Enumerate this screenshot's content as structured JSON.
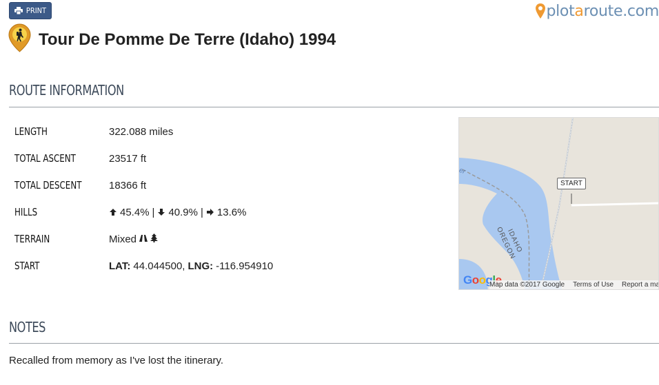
{
  "toolbar": {
    "print_label": "PRINT"
  },
  "brand": {
    "logo_part1": "plot",
    "logo_part2": "a",
    "logo_part3": "route.com"
  },
  "route": {
    "title": "Tour De Pomme De Terre (Idaho) 1994"
  },
  "sections": {
    "route_info": "ROUTE INFORMATION",
    "notes": "NOTES"
  },
  "info": {
    "length_label": "LENGTH",
    "length_value": "322.088 miles",
    "ascent_label": "TOTAL ASCENT",
    "ascent_value": "23517 ft",
    "descent_label": "TOTAL DESCENT",
    "descent_value": "18366 ft",
    "hills_label": "HILLS",
    "hills_up": "45.4%",
    "hills_sep1": "|",
    "hills_down": "40.9%",
    "hills_sep2": "|",
    "hills_flat": "13.6%",
    "terrain_label": "TERRAIN",
    "terrain_value": "Mixed",
    "start_label": "START",
    "lat_label": "LAT:",
    "lat_value": "44.044500,",
    "lng_label": "LNG:",
    "lng_value": "-116.954910"
  },
  "map": {
    "start_marker": "START",
    "river_label": "er",
    "state_label_1": "IDAHO",
    "state_label_2": "OREGON",
    "google": "Google",
    "map_data": "Map data ©2017 Google",
    "terms": "Terms of Use",
    "report": "Report a ma"
  },
  "notes": {
    "text": "Recalled from memory as I've lost the itinerary."
  },
  "colors": {
    "accent": "#3c5a88",
    "heading": "#3d4a5a",
    "brand_orange": "#ef9a33",
    "brand_blue": "#6b8fb3",
    "water": "#a9c8f0",
    "land": "#e8e4dc"
  }
}
